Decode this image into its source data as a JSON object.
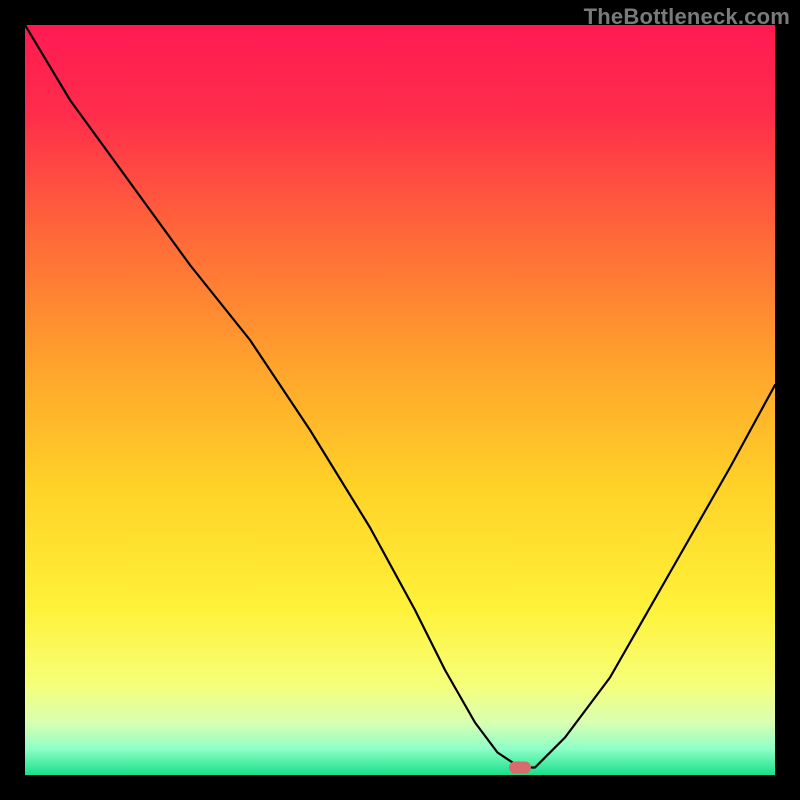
{
  "watermark": "TheBottleneck.com",
  "chart_data": {
    "type": "line",
    "title": "",
    "xlabel": "",
    "ylabel": "",
    "xlim": [
      0,
      100
    ],
    "ylim": [
      0,
      100
    ],
    "series": [
      {
        "name": "bottleneck-curve",
        "x": [
          0,
          6,
          14,
          22,
          30,
          38,
          46,
          52,
          56,
          60,
          63,
          66,
          68,
          72,
          78,
          86,
          94,
          100
        ],
        "y": [
          100,
          90,
          79,
          68,
          58,
          46,
          33,
          22,
          14,
          7,
          3,
          1,
          1,
          5,
          13,
          27,
          41,
          52
        ]
      }
    ],
    "marker": {
      "x": 66,
      "y": 1
    },
    "gradient_stops": [
      {
        "offset": 0.0,
        "color": "#ff1a52"
      },
      {
        "offset": 0.12,
        "color": "#ff2d4b"
      },
      {
        "offset": 0.28,
        "color": "#ff6839"
      },
      {
        "offset": 0.45,
        "color": "#ffa22c"
      },
      {
        "offset": 0.62,
        "color": "#ffd328"
      },
      {
        "offset": 0.78,
        "color": "#fff23a"
      },
      {
        "offset": 0.88,
        "color": "#f6ff7a"
      },
      {
        "offset": 0.93,
        "color": "#d9ffb2"
      },
      {
        "offset": 0.965,
        "color": "#8effc6"
      },
      {
        "offset": 1.0,
        "color": "#18e08a"
      }
    ]
  }
}
